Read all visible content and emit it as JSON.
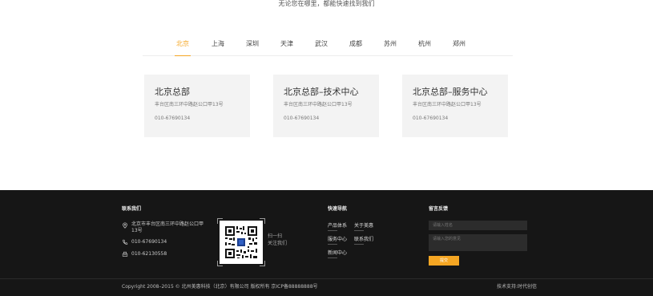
{
  "subtitle": "无论您在哪里，都能快速找到我们",
  "tabs": [
    "北京",
    "上海",
    "深圳",
    "天津",
    "武汉",
    "成都",
    "苏州",
    "杭州",
    "郑州"
  ],
  "active_tab": "北京",
  "cards": [
    {
      "title": "北京总部",
      "address": "丰台区南三环中路赵公口甲13号",
      "phone": "010-67690134"
    },
    {
      "title": "北京总部–技术中心",
      "address": "丰台区南三环中路赵公口甲13号",
      "phone": "010-67690134"
    },
    {
      "title": "北京总部–服务中心",
      "address": "丰台区南三环中路赵公口甲13号",
      "phone": "010-67690134"
    }
  ],
  "footer": {
    "contact": {
      "heading": "联系我们",
      "address_line1": "北京市丰台区南三环中路赵公口甲",
      "address_line2": "13号",
      "phone": "010-67690134",
      "fax": "010-62130558",
      "qr_caption1": "扫一扫",
      "qr_caption2": "关注我们"
    },
    "nav": {
      "heading": "快速导航",
      "links": [
        "产品体系",
        "关于美惠",
        "服务中心",
        "联系我们",
        "新闻中心"
      ]
    },
    "feedback": {
      "heading": "留言反馈",
      "name_placeholder": "请输入姓名",
      "message_placeholder": "请输入您的意见",
      "submit_label": "提交"
    },
    "copyright": "Copyright 2008–2015 © 北州美惠科技（北京）有限公司 版权所有  京ICP备88888888号",
    "tech_support": "技术支持:时代创信"
  },
  "colors": {
    "accent": "#f5a623",
    "footer_bg": "#161616",
    "card_bg": "#f3f3f3"
  }
}
